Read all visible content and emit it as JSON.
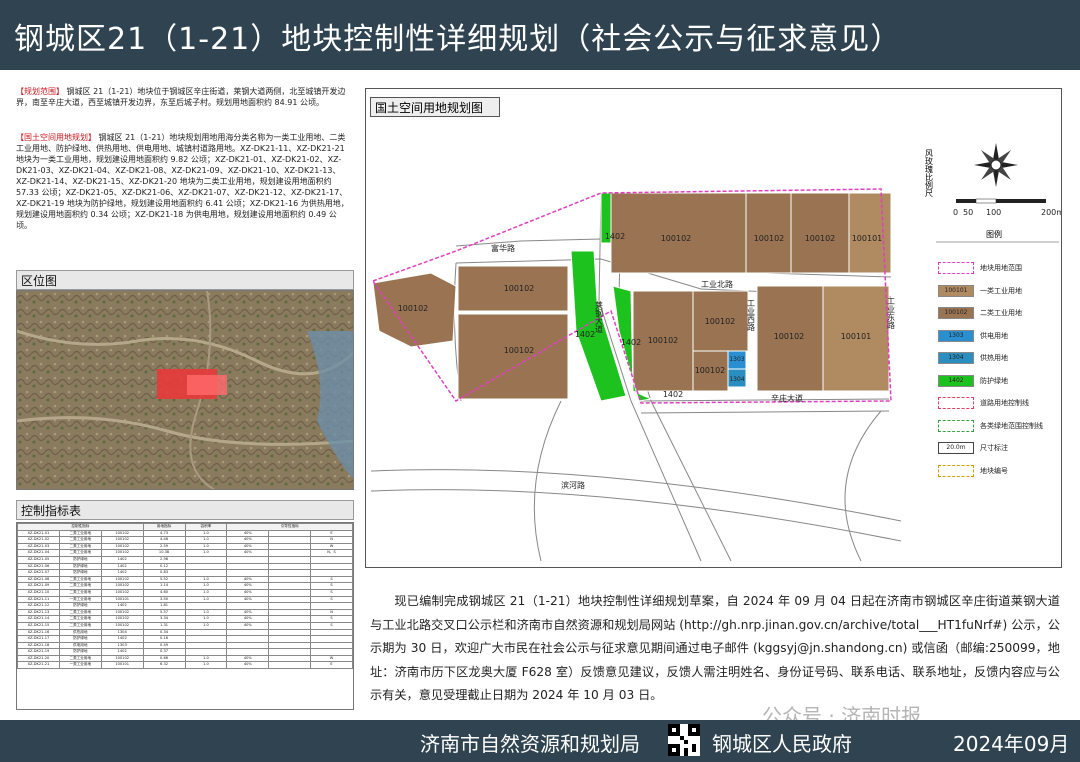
{
  "header": {
    "title": "钢城区21（1-21）地块控制性详细规划（社会公示与征求意见）"
  },
  "left": {
    "scope_label": "【规划范围】",
    "scope_text": "钢城区 21（1-21）地块位于钢城区辛庄街道，莱钢大道两侧，北至城镇开发边界，南至辛庄大道，西至城镇开发边界，东至后城子村。规划用地面积约 84.91 公顷。",
    "landuse_label": "【国土空间用地规划】",
    "landuse_text": "钢城区 21（1-21）地块规划用地用海分类名称为一类工业用地、二类工业用地、防护绿地、供热用地、供电用地、城镇村道路用地。XZ-DK21-11、XZ-DK21-21 地块为一类工业用地，规划建设用地面积约 9.82 公顷；XZ-DK21-01、XZ-DK21-02、XZ-DK21-03、XZ-DK21-04、XZ-DK21-08、XZ-DK21-09、XZ-DK21-10、XZ-DK21-13、XZ-DK21-14、XZ-DK21-15、XZ-DK21-20 地块为二类工业用地，规划建设用地面积约 57.33 公顷；XZ-DK21-05、XZ-DK21-06、XZ-DK21-07、XZ-DK21-12、XZ-DK21-17、XZ-DK21-19 地块为防护绿地，规划建设用地面积约 6.41 公顷；XZ-DK21-16 为供热用地，规划建设用地面积约 0.34 公顷；XZ-DK21-18 为供电用地，规划建设用地面积约 0.49 公顷。",
    "location_title": "区位图",
    "table_title": "控制指标表"
  },
  "table": {
    "group_headers": [
      "控制性指标",
      "用地指标",
      "容积率",
      "引导性指标"
    ],
    "rows": [
      [
        "XZ-DK21-01",
        "二类工业用地",
        "100102",
        "4.73",
        "1.0",
        "40%",
        "",
        "E"
      ],
      [
        "XZ-DK21-02",
        "二类工业用地",
        "100102",
        "4.48",
        "1.0",
        "40%",
        "",
        "N"
      ],
      [
        "XZ-DK21-03",
        "二类工业用地",
        "100102",
        "2.59",
        "1.0",
        "40%",
        "",
        "W"
      ],
      [
        "XZ-DK21-04",
        "二类工业用地",
        "100102",
        "10.38",
        "1.0",
        "40%",
        "",
        "N、S"
      ],
      [
        "XZ-DK21-05",
        "防护绿地",
        "1402",
        "2.98",
        "",
        "",
        "",
        ""
      ],
      [
        "XZ-DK21-06",
        "防护绿地",
        "1402",
        "0.12",
        "",
        "",
        "",
        ""
      ],
      [
        "XZ-DK21-07",
        "防护绿地",
        "1402",
        "0.83",
        "",
        "",
        "",
        ""
      ],
      [
        "XZ-DK21-08",
        "二类工业用地",
        "100102",
        "5.52",
        "1.0",
        "40%",
        "",
        "S"
      ],
      [
        "XZ-DK21-09",
        "二类工业用地",
        "100102",
        "1.14",
        "1.0",
        "40%",
        "",
        "S"
      ],
      [
        "XZ-DK21-10",
        "二类工业用地",
        "100102",
        "4.60",
        "1.0",
        "40%",
        "",
        "S"
      ],
      [
        "XZ-DK21-11",
        "一类工业用地",
        "100101",
        "3.50",
        "1.0",
        "40%",
        "",
        "S"
      ],
      [
        "XZ-DK21-12",
        "防护绿地",
        "1402",
        "1.81",
        "",
        "",
        "",
        ""
      ],
      [
        "XZ-DK21-13",
        "二类工业用地",
        "100102",
        "5.57",
        "1.0",
        "40%",
        "",
        "N"
      ],
      [
        "XZ-DK21-14",
        "二类工业用地",
        "100102",
        "3.34",
        "1.0",
        "40%",
        "",
        "S"
      ],
      [
        "XZ-DK21-15",
        "二类工业用地",
        "100102",
        "1.31",
        "1.0",
        "40%",
        "",
        "S"
      ],
      [
        "XZ-DK21-16",
        "供热用地",
        "1304",
        "0.34",
        "",
        "",
        "",
        ""
      ],
      [
        "XZ-DK21-17",
        "防护绿地",
        "1402",
        "0.16",
        "",
        "",
        "",
        ""
      ],
      [
        "XZ-DK21-18",
        "供电用地",
        "1303",
        "0.49",
        "",
        "",
        "",
        ""
      ],
      [
        "XZ-DK21-19",
        "防护绿地",
        "1402",
        "0.37",
        "",
        "",
        "",
        ""
      ],
      [
        "XZ-DK21-20",
        "二类工业用地",
        "100102",
        "0.66",
        "1.0",
        "40%",
        "",
        "W"
      ],
      [
        "XZ-DK21-21",
        "一类工业用地",
        "100101",
        "6.32",
        "1.0",
        "40%",
        "",
        "E"
      ]
    ]
  },
  "map": {
    "title": "国土空间用地规划图",
    "roads": {
      "fucai": "富华路",
      "laigang": "莱钢大道",
      "gongye_north": "工业北路",
      "gongye_west": "工业西路",
      "gongye_east": "工业东路",
      "xinzhuang": "辛庄大道",
      "binhe": "滨河路"
    },
    "parcels": [
      "100102",
      "100102",
      "100102",
      "100102",
      "100102",
      "100101",
      "100102",
      "100102",
      "100102",
      "100102",
      "100101",
      "1402",
      "1402",
      "1402",
      "1402",
      "1303",
      "1304"
    ],
    "north_label": "风玫瑰比例尺",
    "scale": [
      "0",
      "50",
      "100",
      "200m"
    ],
    "legend_title": "图例",
    "legend": [
      {
        "code": "",
        "label": "地块用地范围",
        "color": "#ffffff",
        "border": "#e040c0"
      },
      {
        "code": "100101",
        "label": "一类工业用地",
        "color": "#b08a60"
      },
      {
        "code": "100102",
        "label": "二类工业用地",
        "color": "#9a7452"
      },
      {
        "code": "1303",
        "label": "供电用地",
        "color": "#2a8fd0"
      },
      {
        "code": "1304",
        "label": "供热用地",
        "color": "#2a8fc0"
      },
      {
        "code": "1402",
        "label": "防护绿地",
        "color": "#1ec21e"
      },
      {
        "code": "",
        "label": "道路用地控制线",
        "color": "#ffffff",
        "border": "#e04060"
      },
      {
        "code": "",
        "label": "各类绿地范围控制线",
        "color": "#ffffff",
        "border": "#3aa040"
      },
      {
        "code": "20.0m",
        "label": "尺寸标注",
        "color": "#ffffff",
        "border": "#444"
      },
      {
        "code": "",
        "label": "地块编号",
        "color": "#ffffff",
        "border": "#d4a000"
      }
    ]
  },
  "notice": "现已编制完成钢城区 21（1-21）地块控制性详细规划草案，自 2024 年 09 月 04 日起在济南市钢城区辛庄街道莱钢大道与工业北路交叉口公示栏和济南市自然资源和规划局网站 (http://gh.nrp.jinan.gov.cn/archive/total___HT1fuNrf#) 公示，公示期为 30 日，欢迎广大市民在社会公示与征求意见期间通过电子邮件 (kggsyj@jn.shandong.cn) 或信函（邮编:250099，地址：济南市历下区龙奥大厦 F628 室）反馈意见建议，反馈人需注明姓名、身份证号码、联系电话、联系地址，反馈内容应与公示有关，意见受理截止日期为 2024 年 10 月 03 日。",
  "footer": {
    "org1": "济南市自然资源和规划局",
    "org2": "钢城区人民政府",
    "date": "2024年09月"
  },
  "watermark": "公众号 · 济南时报"
}
